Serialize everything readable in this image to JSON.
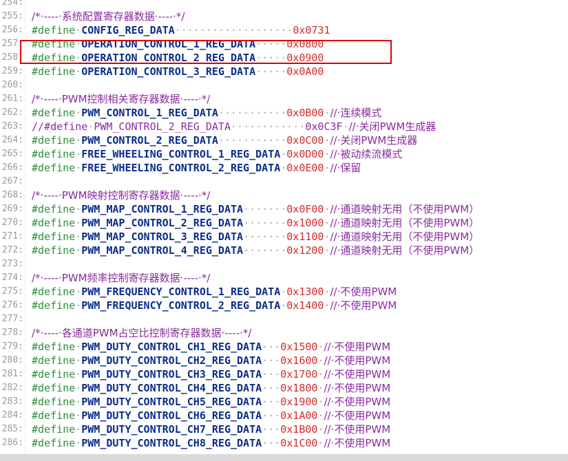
{
  "lines": [
    {
      "n": "254:",
      "type": "blank"
    },
    {
      "n": "255:",
      "type": "comment",
      "text": "/*·----·系统配置寄存器数据·----·*/"
    },
    {
      "n": "256:",
      "type": "define",
      "kw": "#define",
      "name": "CONFIG_REG_DATA",
      "dots": "···················",
      "val": "0x0731",
      "cmt": ""
    },
    {
      "n": "257:",
      "type": "define",
      "kw": "#define",
      "name": "OPERATION_CONTROL_1_REG_DATA",
      "dots": "·····",
      "val": "0x0800",
      "cmt": ""
    },
    {
      "n": "258:",
      "type": "define",
      "kw": "#define",
      "name": "OPERATION_CONTROL_2_REG_DATA",
      "dots": "·····",
      "val": "0x0900",
      "cmt": ""
    },
    {
      "n": "259:",
      "type": "define",
      "kw": "#define",
      "name": "OPERATION_CONTROL_3_REG_DATA",
      "dots": "·····",
      "val": "0x0A00",
      "cmt": ""
    },
    {
      "n": "260:",
      "type": "blank"
    },
    {
      "n": "261:",
      "type": "comment",
      "text": "/*·----·PWM控制相关寄存器数据·----·*/"
    },
    {
      "n": "262:",
      "type": "define",
      "kw": "#define",
      "name": "PWM_CONTROL_1_REG_DATA",
      "dots": "···········",
      "val": "0x0B00",
      "cmt": "//·连续模式"
    },
    {
      "n": "263:",
      "type": "define",
      "kw": "//#define",
      "name": "PWM_CONTROL_2_REG_DATA",
      "dots": "············",
      "val": "0x0C3F",
      "cmt": "//·关闭PWM生成器",
      "commented": true
    },
    {
      "n": "264:",
      "type": "define",
      "kw": "#define",
      "name": "PWM_CONTROL_2_REG_DATA",
      "dots": "···········",
      "val": "0x0C00",
      "cmt": "//·关闭PWM生成器"
    },
    {
      "n": "265:",
      "type": "define",
      "kw": "#define",
      "name": "FREE_WHEELING_CONTROL_1_REG_DATA",
      "dots": "·",
      "val": "0x0D00",
      "cmt": "//·被动续流模式"
    },
    {
      "n": "266:",
      "type": "define",
      "kw": "#define",
      "name": "FREE_WHEELING_CONTROL_2_REG_DATA",
      "dots": "·",
      "val": "0x0E00",
      "cmt": "//·保留"
    },
    {
      "n": "267:",
      "type": "blank"
    },
    {
      "n": "268:",
      "type": "comment",
      "text": "/*·----·PWM映射控制寄存器数据·----·*/"
    },
    {
      "n": "269:",
      "type": "define",
      "kw": "#define",
      "name": "PWM_MAP_CONTROL_1_REG_DATA",
      "dots": "·······",
      "val": "0x0F00",
      "cmt": "//·通道映射无用（不使用PWM）"
    },
    {
      "n": "270:",
      "type": "define",
      "kw": "#define",
      "name": "PWM_MAP_CONTROL_2_REG_DATA",
      "dots": "·······",
      "val": "0x1000",
      "cmt": "//·通道映射无用（不使用PWM）"
    },
    {
      "n": "271:",
      "type": "define",
      "kw": "#define",
      "name": "PWM_MAP_CONTROL_3_REG_DATA",
      "dots": "·······",
      "val": "0x1100",
      "cmt": "//·通道映射无用（不使用PWM）"
    },
    {
      "n": "272:",
      "type": "define",
      "kw": "#define",
      "name": "PWM_MAP_CONTROL_4_REG_DATA",
      "dots": "·······",
      "val": "0x1200",
      "cmt": "//·通道映射无用（不使用PWM）"
    },
    {
      "n": "273:",
      "type": "blank"
    },
    {
      "n": "274:",
      "type": "comment",
      "text": "/*·----·PWM频率控制寄存器数据·----·*/"
    },
    {
      "n": "275:",
      "type": "define",
      "kw": "#define",
      "name": "PWM_FREQUENCY_CONTROL_1_REG_DATA",
      "dots": "·",
      "val": "0x1300",
      "cmt": "//·不使用PWM"
    },
    {
      "n": "276:",
      "type": "define",
      "kw": "#define",
      "name": "PWM_FREQUENCY_CONTROL_2_REG_DATA",
      "dots": "·",
      "val": "0x1400",
      "cmt": "//·不使用PWM"
    },
    {
      "n": "277:",
      "type": "blank"
    },
    {
      "n": "278:",
      "type": "comment",
      "text": "/*·----·各通道PWM占空比控制寄存器数据·----·*/"
    },
    {
      "n": "279:",
      "type": "define",
      "kw": "#define",
      "name": "PWM_DUTY_CONTROL_CH1_REG_DATA",
      "dots": "···",
      "val": "0x1500",
      "cmt": "//·不使用PWM"
    },
    {
      "n": "280:",
      "type": "define",
      "kw": "#define",
      "name": "PWM_DUTY_CONTROL_CH2_REG_DATA",
      "dots": "···",
      "val": "0x1600",
      "cmt": "//·不使用PWM"
    },
    {
      "n": "281:",
      "type": "define",
      "kw": "#define",
      "name": "PWM_DUTY_CONTROL_CH3_REG_DATA",
      "dots": "···",
      "val": "0x1700",
      "cmt": "//·不使用PWM"
    },
    {
      "n": "282:",
      "type": "define",
      "kw": "#define",
      "name": "PWM_DUTY_CONTROL_CH4_REG_DATA",
      "dots": "···",
      "val": "0x1800",
      "cmt": "//·不使用PWM"
    },
    {
      "n": "283:",
      "type": "define",
      "kw": "#define",
      "name": "PWM_DUTY_CONTROL_CH5_REG_DATA",
      "dots": "···",
      "val": "0x1900",
      "cmt": "//·不使用PWM"
    },
    {
      "n": "284:",
      "type": "define",
      "kw": "#define",
      "name": "PWM_DUTY_CONTROL_CH6_REG_DATA",
      "dots": "···",
      "val": "0x1A00",
      "cmt": "//·不使用PWM"
    },
    {
      "n": "285:",
      "type": "define",
      "kw": "#define",
      "name": "PWM_DUTY_CONTROL_CH7_REG_DATA",
      "dots": "···",
      "val": "0x1B00",
      "cmt": "//·不使用PWM"
    },
    {
      "n": "286:",
      "type": "define",
      "kw": "#define",
      "name": "PWM_DUTY_CONTROL_CH8_REG_DATA",
      "dots": "···",
      "val": "0x1C00",
      "cmt": "//·不使用PWM"
    }
  ],
  "colors": {
    "keyword": "#2d8f3a",
    "macro": "#0a2c8a",
    "value": "#d12b2b",
    "comment": "#8a2b9e",
    "highlight": "#e00000"
  }
}
